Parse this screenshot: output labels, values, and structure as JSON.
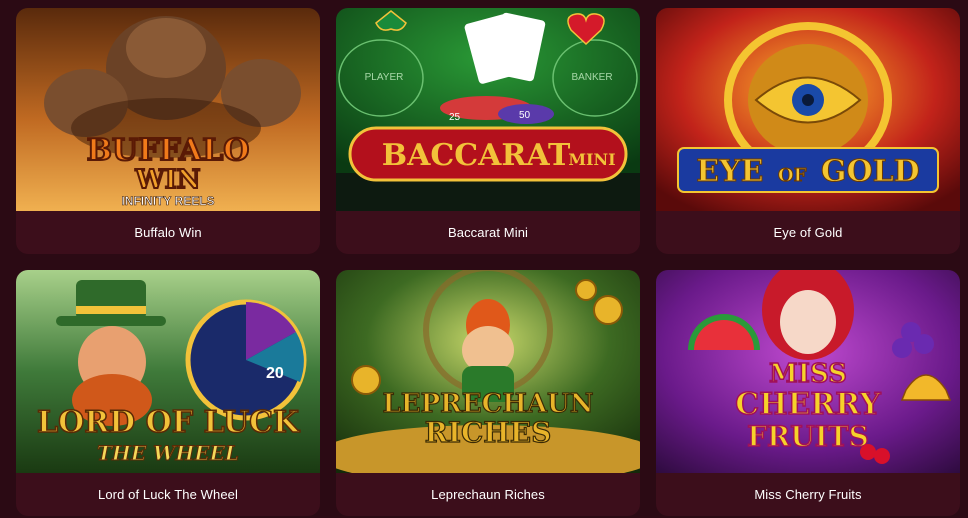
{
  "games": [
    {
      "title": "Buffalo Win",
      "logo_line1": "BUFFALO",
      "logo_line2": "WIN",
      "logo_sub": "INFINITY REELS",
      "colors": {
        "bg1": "#7a3a10",
        "bg2": "#e08a2a",
        "logo": "#f07a1a"
      }
    },
    {
      "title": "Baccarat Mini",
      "logo_main": "BACCARAT",
      "logo_mini": "MINI",
      "label_left": "PLAYER",
      "label_right": "BANKER",
      "chip_values": [
        "25",
        "50"
      ],
      "colors": {
        "felt": "#1e7a2a",
        "banner": "#b3101c",
        "gold": "#f2c23a"
      }
    },
    {
      "title": "Eye of Gold",
      "logo_words": [
        "EYE",
        "OF",
        "GOLD"
      ],
      "colors": {
        "bg": "#c2231a",
        "gold": "#f4c531",
        "eye": "#1a4aa8"
      }
    },
    {
      "title": "Lord of Luck The Wheel",
      "logo_line1": "LORD OF LUCK",
      "logo_line2": "THE WHEEL",
      "wheel_number": "20",
      "colors": {
        "bg": "#3f7a3a",
        "hat": "#2f6a2a",
        "gold": "#f2c23a"
      }
    },
    {
      "title": "Leprechaun Riches",
      "logo_line1": "LEPRECHAUN",
      "logo_line2": "RICHES",
      "colors": {
        "bg": "#3d6a22",
        "gold": "#e8b42a",
        "hair": "#e0581a"
      }
    },
    {
      "title": "Miss Cherry Fruits",
      "logo_line1": "MISS",
      "logo_line2": "CHERRY",
      "logo_line3": "FRUITS",
      "colors": {
        "bg": "#6a1a8a",
        "logo": "#f6d22a",
        "cherry": "#d8102a"
      }
    }
  ]
}
